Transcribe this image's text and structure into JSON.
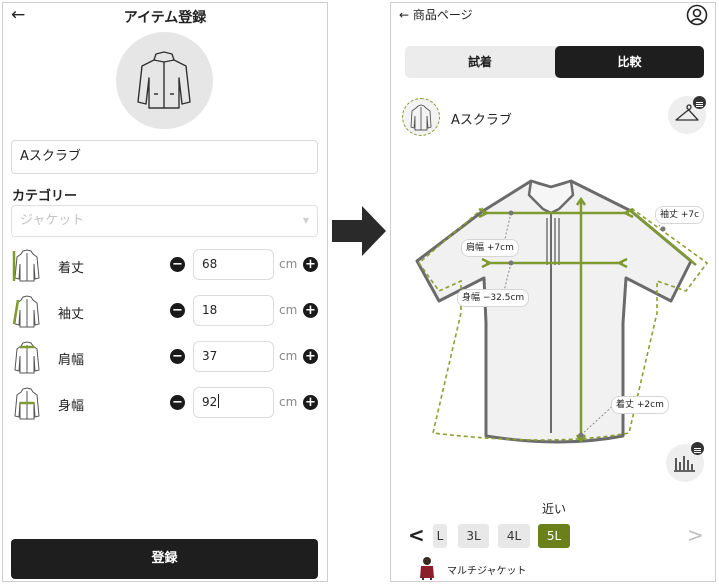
{
  "left_screen": {
    "title": "アイテム登録",
    "back_icon": "arrow-left-icon",
    "item_name_value": "Aスクラブ",
    "category_label": "カテゴリー",
    "category_placeholder": "ジャケット",
    "measurements": [
      {
        "label": "着丈",
        "value": "68",
        "unit": "cm",
        "icon": "jacket-length-icon"
      },
      {
        "label": "袖丈",
        "value": "18",
        "unit": "cm",
        "icon": "jacket-sleeve-icon"
      },
      {
        "label": "肩幅",
        "value": "37",
        "unit": "cm",
        "icon": "jacket-shoulder-icon"
      },
      {
        "label": "身幅",
        "value": "92",
        "unit": "cm",
        "icon": "jacket-chest-icon"
      }
    ],
    "minus_symbol": "−",
    "plus_symbol": "+",
    "register_label": "登録"
  },
  "right_screen": {
    "back_label": "← 商品ページ",
    "user_icon": "user-circle-icon",
    "tabs": [
      {
        "label": "試着",
        "active": false
      },
      {
        "label": "比較",
        "active": true
      }
    ],
    "item_name": "Aスクラブ",
    "hanger_icon": "hanger-settings-icon",
    "chart_icon": "bar-chart-settings-icon",
    "annotations": {
      "sleeve": "袖丈 +7c",
      "shoulder": "肩幅 +7cm",
      "chest": "身幅 −32.5cm",
      "length": "着丈 +2cm"
    },
    "fit_label": "近い",
    "sizes": [
      {
        "label": "L",
        "selected": false
      },
      {
        "label": "3L",
        "selected": false
      },
      {
        "label": "4L",
        "selected": false
      },
      {
        "label": "5L",
        "selected": true
      }
    ],
    "prev_symbol": "<",
    "next_symbol": ">",
    "brand_name": "マルチジャケット"
  },
  "colors": {
    "accent_olive": "#6b7f1b",
    "line_green": "#7f9a2e",
    "dark": "#1e1e1e"
  }
}
